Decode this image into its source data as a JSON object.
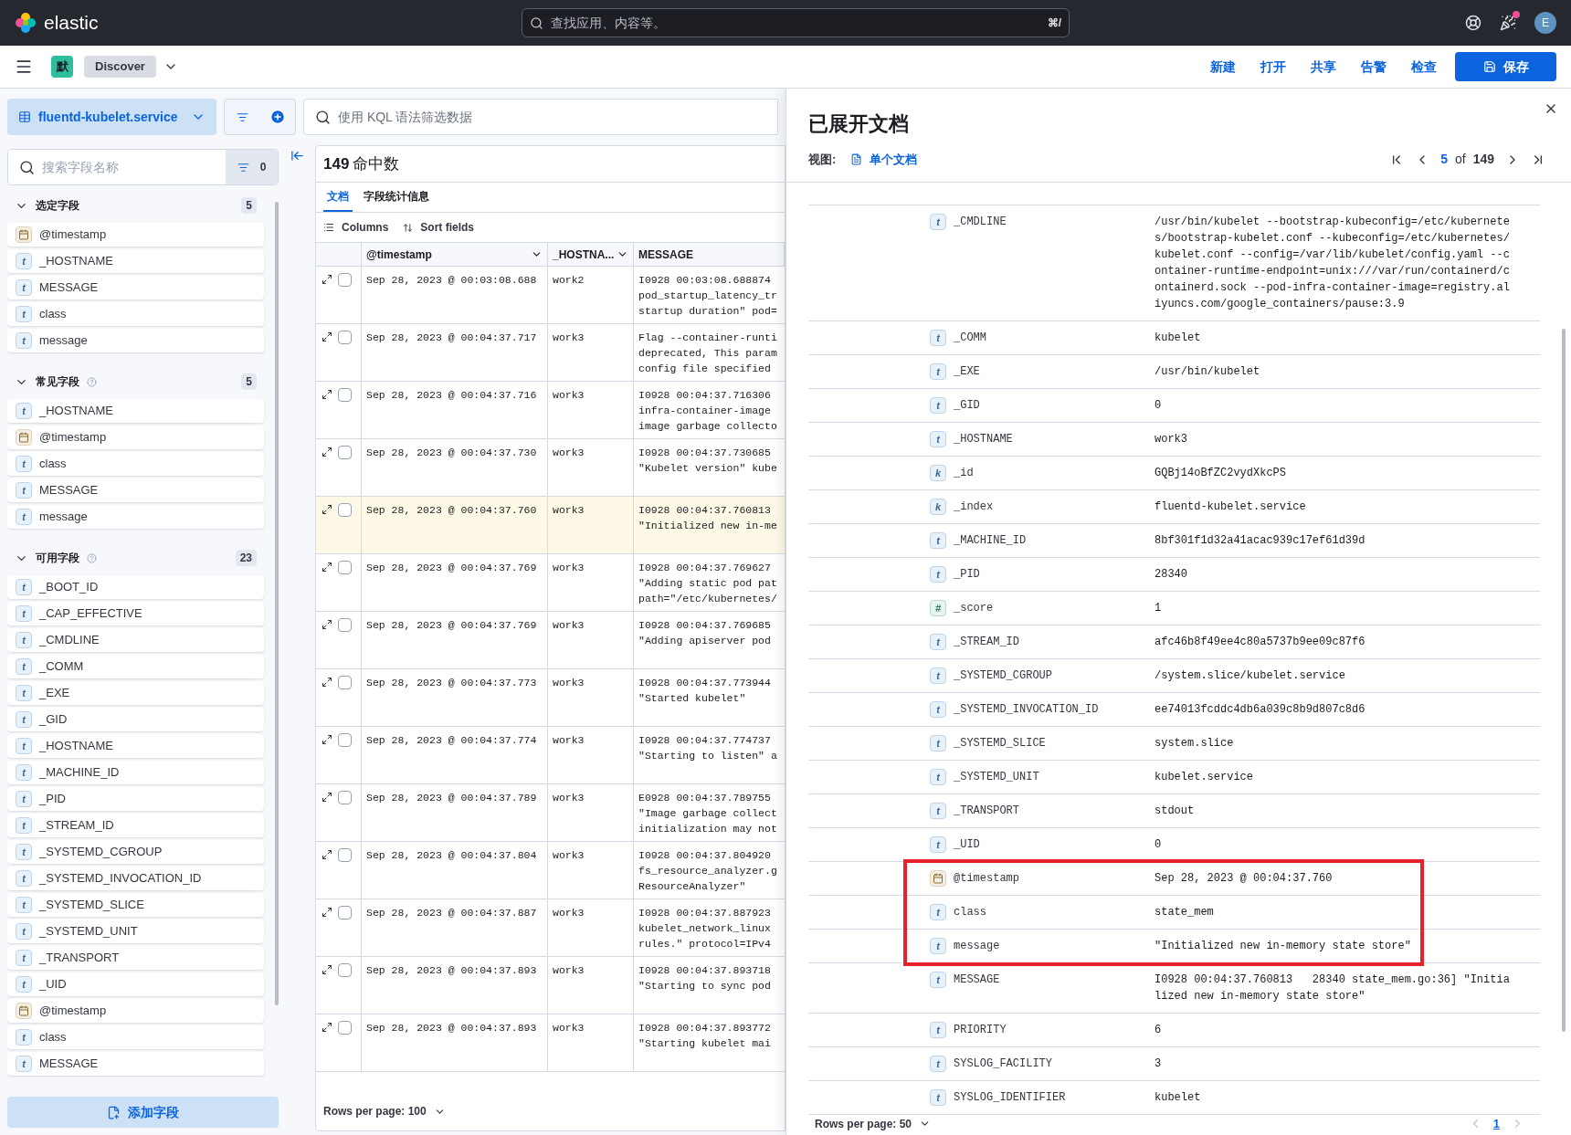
{
  "top_bar": {
    "brand": "elastic",
    "search": {
      "placeholder": "查找应用、内容等。",
      "shortcut": "⌘/"
    },
    "news_unread": true,
    "avatar": "E"
  },
  "app_bar": {
    "space": "默",
    "breadcrumb": "Discover",
    "links": [
      "新建",
      "打开",
      "共享",
      "告警",
      "检查"
    ],
    "save": "保存"
  },
  "query_bar": {
    "data_view": "fluentd-kubelet.service",
    "placeholder": "使用 KQL 语法筛选数据"
  },
  "sidebar": {
    "search": {
      "placeholder": "搜索字段名称"
    },
    "filter_count": "0",
    "sections": [
      {
        "title": "选定字段",
        "count": "5",
        "help": false,
        "expanded": true,
        "fields": [
          {
            "name": "@timestamp",
            "kind": "date"
          },
          {
            "name": "_HOSTNAME",
            "kind": "string",
            "badge": "t"
          },
          {
            "name": "MESSAGE",
            "kind": "string",
            "badge": "t"
          },
          {
            "name": "class",
            "kind": "string",
            "badge": "t"
          },
          {
            "name": "message",
            "kind": "string",
            "badge": "t"
          }
        ]
      },
      {
        "title": "常见字段",
        "count": "5",
        "help": true,
        "expanded": true,
        "fields": [
          {
            "name": "_HOSTNAME",
            "kind": "string",
            "badge": "t"
          },
          {
            "name": "@timestamp",
            "kind": "date"
          },
          {
            "name": "class",
            "kind": "string",
            "badge": "t"
          },
          {
            "name": "MESSAGE",
            "kind": "string",
            "badge": "t"
          },
          {
            "name": "message",
            "kind": "string",
            "badge": "t"
          }
        ]
      },
      {
        "title": "可用字段",
        "count": "23",
        "help": true,
        "expanded": true,
        "fields": [
          {
            "name": "_BOOT_ID",
            "kind": "string",
            "badge": "t"
          },
          {
            "name": "_CAP_EFFECTIVE",
            "kind": "string",
            "badge": "t"
          },
          {
            "name": "_CMDLINE",
            "kind": "string",
            "badge": "t"
          },
          {
            "name": "_COMM",
            "kind": "string",
            "badge": "t"
          },
          {
            "name": "_EXE",
            "kind": "string",
            "badge": "t"
          },
          {
            "name": "_GID",
            "kind": "string",
            "badge": "t"
          },
          {
            "name": "_HOSTNAME",
            "kind": "string",
            "badge": "t"
          },
          {
            "name": "_MACHINE_ID",
            "kind": "string",
            "badge": "t"
          },
          {
            "name": "_PID",
            "kind": "string",
            "badge": "t"
          },
          {
            "name": "_STREAM_ID",
            "kind": "string",
            "badge": "t"
          },
          {
            "name": "_SYSTEMD_CGROUP",
            "kind": "string",
            "badge": "t"
          },
          {
            "name": "_SYSTEMD_INVOCATION_ID",
            "kind": "string",
            "badge": "t"
          },
          {
            "name": "_SYSTEMD_SLICE",
            "kind": "string",
            "badge": "t"
          },
          {
            "name": "_SYSTEMD_UNIT",
            "kind": "string",
            "badge": "t"
          },
          {
            "name": "_TRANSPORT",
            "kind": "string",
            "badge": "t"
          },
          {
            "name": "_UID",
            "kind": "string",
            "badge": "t"
          },
          {
            "name": "@timestamp",
            "kind": "date"
          },
          {
            "name": "class",
            "kind": "string",
            "badge": "t"
          },
          {
            "name": "MESSAGE",
            "kind": "string",
            "badge": "t"
          }
        ]
      }
    ],
    "add_field": "添加字段"
  },
  "results": {
    "hits": "149",
    "hits_label": "命中数",
    "tabs": [
      {
        "label": "文档",
        "selected": true
      },
      {
        "label": "字段统计信息",
        "selected": false
      }
    ],
    "toolbar": [
      "Columns",
      "Sort fields"
    ],
    "columns": [
      "@timestamp",
      "_HOSTNA...",
      "MESSAGE"
    ],
    "rows": [
      {
        "timestamp": "Sep 28, 2023 @ 00:03:08.688",
        "host": "work2",
        "message": "I0928 00:03:08.688874\npod_startup_latency_tr\nstartup duration\" pod=",
        "checked": false,
        "selected": false
      },
      {
        "timestamp": "Sep 28, 2023 @ 00:04:37.717",
        "host": "work3",
        "message": "Flag --container-runti\ndeprecated, This param\nconfig file specified",
        "checked": false,
        "selected": false
      },
      {
        "timestamp": "Sep 28, 2023 @ 00:04:37.716",
        "host": "work3",
        "message": "I0928 00:04:37.716306\ninfra-container-image\nimage garbage collecto",
        "checked": false,
        "selected": false
      },
      {
        "timestamp": "Sep 28, 2023 @ 00:04:37.730",
        "host": "work3",
        "message": "I0928 00:04:37.730685\n\"Kubelet version\" kube",
        "checked": false,
        "selected": false
      },
      {
        "timestamp": "Sep 28, 2023 @ 00:04:37.760",
        "host": "work3",
        "message": "I0928 00:04:37.760813\n\"Initialized new in-me",
        "checked": false,
        "selected": true
      },
      {
        "timestamp": "Sep 28, 2023 @ 00:04:37.769",
        "host": "work3",
        "message": "I0928 00:04:37.769627\n\"Adding static pod pat\npath=\"/etc/kubernetes/",
        "checked": false,
        "selected": false
      },
      {
        "timestamp": "Sep 28, 2023 @ 00:04:37.769",
        "host": "work3",
        "message": "I0928 00:04:37.769685\n\"Adding apiserver pod",
        "checked": false,
        "selected": false
      },
      {
        "timestamp": "Sep 28, 2023 @ 00:04:37.773",
        "host": "work3",
        "message": "I0928 00:04:37.773944\n\"Started kubelet\"",
        "checked": false,
        "selected": false
      },
      {
        "timestamp": "Sep 28, 2023 @ 00:04:37.774",
        "host": "work3",
        "message": "I0928 00:04:37.774737\n\"Starting to listen\" a",
        "checked": false,
        "selected": false
      },
      {
        "timestamp": "Sep 28, 2023 @ 00:04:37.789",
        "host": "work3",
        "message": "E0928 00:04:37.789755\n\"Image garbage collect\ninitialization may not",
        "checked": false,
        "selected": false
      },
      {
        "timestamp": "Sep 28, 2023 @ 00:04:37.804",
        "host": "work3",
        "message": "I0928 00:04:37.804920\nfs_resource_analyzer.g\nResourceAnalyzer\"",
        "checked": false,
        "selected": false
      },
      {
        "timestamp": "Sep 28, 2023 @ 00:04:37.887",
        "host": "work3",
        "message": "I0928 00:04:37.887923\nkubelet_network_linux\nrules.\" protocol=IPv4",
        "checked": false,
        "selected": false
      },
      {
        "timestamp": "Sep 28, 2023 @ 00:04:37.893",
        "host": "work3",
        "message": "I0928 00:04:37.893718\n\"Starting to sync pod",
        "checked": false,
        "selected": false
      },
      {
        "timestamp": "Sep 28, 2023 @ 00:04:37.893",
        "host": "work3",
        "message": "I0928 00:04:37.893772\n\"Starting kubelet mai",
        "checked": false,
        "selected": false
      }
    ],
    "rows_per_page": "Rows per page: 100"
  },
  "flyout": {
    "title": "已展开文档",
    "view_label": "视图:",
    "view_mode": "单个文档",
    "pager": {
      "current": "5",
      "of": "of",
      "total": "149"
    },
    "fields": [
      {
        "name": "_CMDLINE",
        "kind": "string",
        "badge": "t",
        "value": "/usr/bin/kubelet --bootstrap-kubeconfig=/etc/kubernetes/bootstrap-kubelet.conf --kubeconfig=/etc/kubernetes/kubelet.conf --config=/var/lib/kubelet/config.yaml --container-runtime-endpoint=unix:///var/run/containerd/containerd.sock --pod-infra-container-image=registry.aliyuncs.com/google_containers/pause:3.9",
        "highlighted": false
      },
      {
        "name": "_COMM",
        "kind": "string",
        "badge": "t",
        "value": "kubelet",
        "highlighted": false
      },
      {
        "name": "_EXE",
        "kind": "string",
        "badge": "t",
        "value": "/usr/bin/kubelet",
        "highlighted": false
      },
      {
        "name": "_GID",
        "kind": "string",
        "badge": "t",
        "value": "0",
        "highlighted": false
      },
      {
        "name": "_HOSTNAME",
        "kind": "string",
        "badge": "t",
        "value": "work3",
        "highlighted": false
      },
      {
        "name": "_id",
        "kind": "keyword",
        "badge": "k",
        "value": "GQBj14oBfZC2vydXkcPS",
        "highlighted": false
      },
      {
        "name": "_index",
        "kind": "keyword",
        "badge": "k",
        "value": "fluentd-kubelet.service",
        "highlighted": false
      },
      {
        "name": "_MACHINE_ID",
        "kind": "string",
        "badge": "t",
        "value": "8bf301f1d32a41acac939c17ef61d39d",
        "highlighted": false
      },
      {
        "name": "_PID",
        "kind": "string",
        "badge": "t",
        "value": "28340",
        "highlighted": false
      },
      {
        "name": "_score",
        "kind": "number",
        "badge": "#",
        "value": "1",
        "highlighted": false
      },
      {
        "name": "_STREAM_ID",
        "kind": "string",
        "badge": "t",
        "value": "afc46b8f49ee4c80a5737b9ee09c87f6",
        "highlighted": false
      },
      {
        "name": "_SYSTEMD_CGROUP",
        "kind": "string",
        "badge": "t",
        "value": "/system.slice/kubelet.service",
        "highlighted": false
      },
      {
        "name": "_SYSTEMD_INVOCATION_ID",
        "kind": "string",
        "badge": "t",
        "value": "ee74013fcddc4db6a039c8b9d807c8d6",
        "highlighted": false
      },
      {
        "name": "_SYSTEMD_SLICE",
        "kind": "string",
        "badge": "t",
        "value": "system.slice",
        "highlighted": false
      },
      {
        "name": "_SYSTEMD_UNIT",
        "kind": "string",
        "badge": "t",
        "value": "kubelet.service",
        "highlighted": false
      },
      {
        "name": "_TRANSPORT",
        "kind": "string",
        "badge": "t",
        "value": "stdout",
        "highlighted": false
      },
      {
        "name": "_UID",
        "kind": "string",
        "badge": "t",
        "value": "0",
        "highlighted": false
      },
      {
        "name": "@timestamp",
        "kind": "date",
        "value": "Sep 28, 2023 @ 00:04:37.760",
        "highlighted": true
      },
      {
        "name": "class",
        "kind": "string",
        "badge": "t",
        "value": "state_mem",
        "highlighted": true
      },
      {
        "name": "message",
        "kind": "string",
        "badge": "t",
        "value": "\"Initialized new in-memory state store\"",
        "highlighted": true
      },
      {
        "name": "MESSAGE",
        "kind": "string",
        "badge": "t",
        "value": "I0928 00:04:37.760813   28340 state_mem.go:36] \"Initialized new in-memory state store\"",
        "highlighted": false
      },
      {
        "name": "PRIORITY",
        "kind": "string",
        "badge": "t",
        "value": "6",
        "highlighted": false
      },
      {
        "name": "SYSLOG_FACILITY",
        "kind": "string",
        "badge": "t",
        "value": "3",
        "highlighted": false
      },
      {
        "name": "SYSLOG_IDENTIFIER",
        "kind": "string",
        "badge": "t",
        "value": "kubelet",
        "highlighted": false
      }
    ],
    "rows_per_page": "Rows per page: 50",
    "pages": [
      {
        "label": "1",
        "selected": true
      }
    ]
  }
}
